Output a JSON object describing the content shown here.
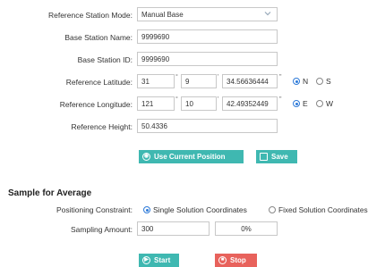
{
  "form": {
    "mode_label": "Reference Station Mode:",
    "mode_value": "Manual Base",
    "base_name_label": "Base Station Name:",
    "base_name_value": "9999690",
    "base_id_label": "Base Station ID:",
    "base_id_value": "9999690",
    "lat_label": "Reference Latitude:",
    "lat_deg": "31",
    "lat_min": "9",
    "lat_sec": "34.56636444",
    "lat_n": "N",
    "lat_s": "S",
    "lon_label": "Reference Longitude:",
    "lon_deg": "121",
    "lon_min": "10",
    "lon_sec": "42.49352449",
    "lon_e": "E",
    "lon_w": "W",
    "height_label": "Reference Height:",
    "height_value": "50.4336",
    "deg_mark": "°",
    "min_mark": "'",
    "sec_mark": "\""
  },
  "buttons": {
    "use_current": "Use Current Position",
    "save": "Save",
    "start": "Start",
    "stop": "Stop"
  },
  "average": {
    "title": "Sample for Average",
    "constraint_label": "Positioning Constraint:",
    "single_option": "Single Solution Coordinates",
    "fixed_option": "Fixed Solution Coordinates",
    "sampling_label": "Sampling Amount:",
    "sampling_value": "300",
    "progress_text": "0%"
  },
  "colors": {
    "teal": "#3fb8b1",
    "red": "#e8625c",
    "radio_accent": "#2e7ad8"
  },
  "icons": {
    "location": "location-icon",
    "save": "save-icon",
    "start": "play-icon",
    "stop": "stop-icon",
    "dropdown": "chevron-down-icon"
  }
}
